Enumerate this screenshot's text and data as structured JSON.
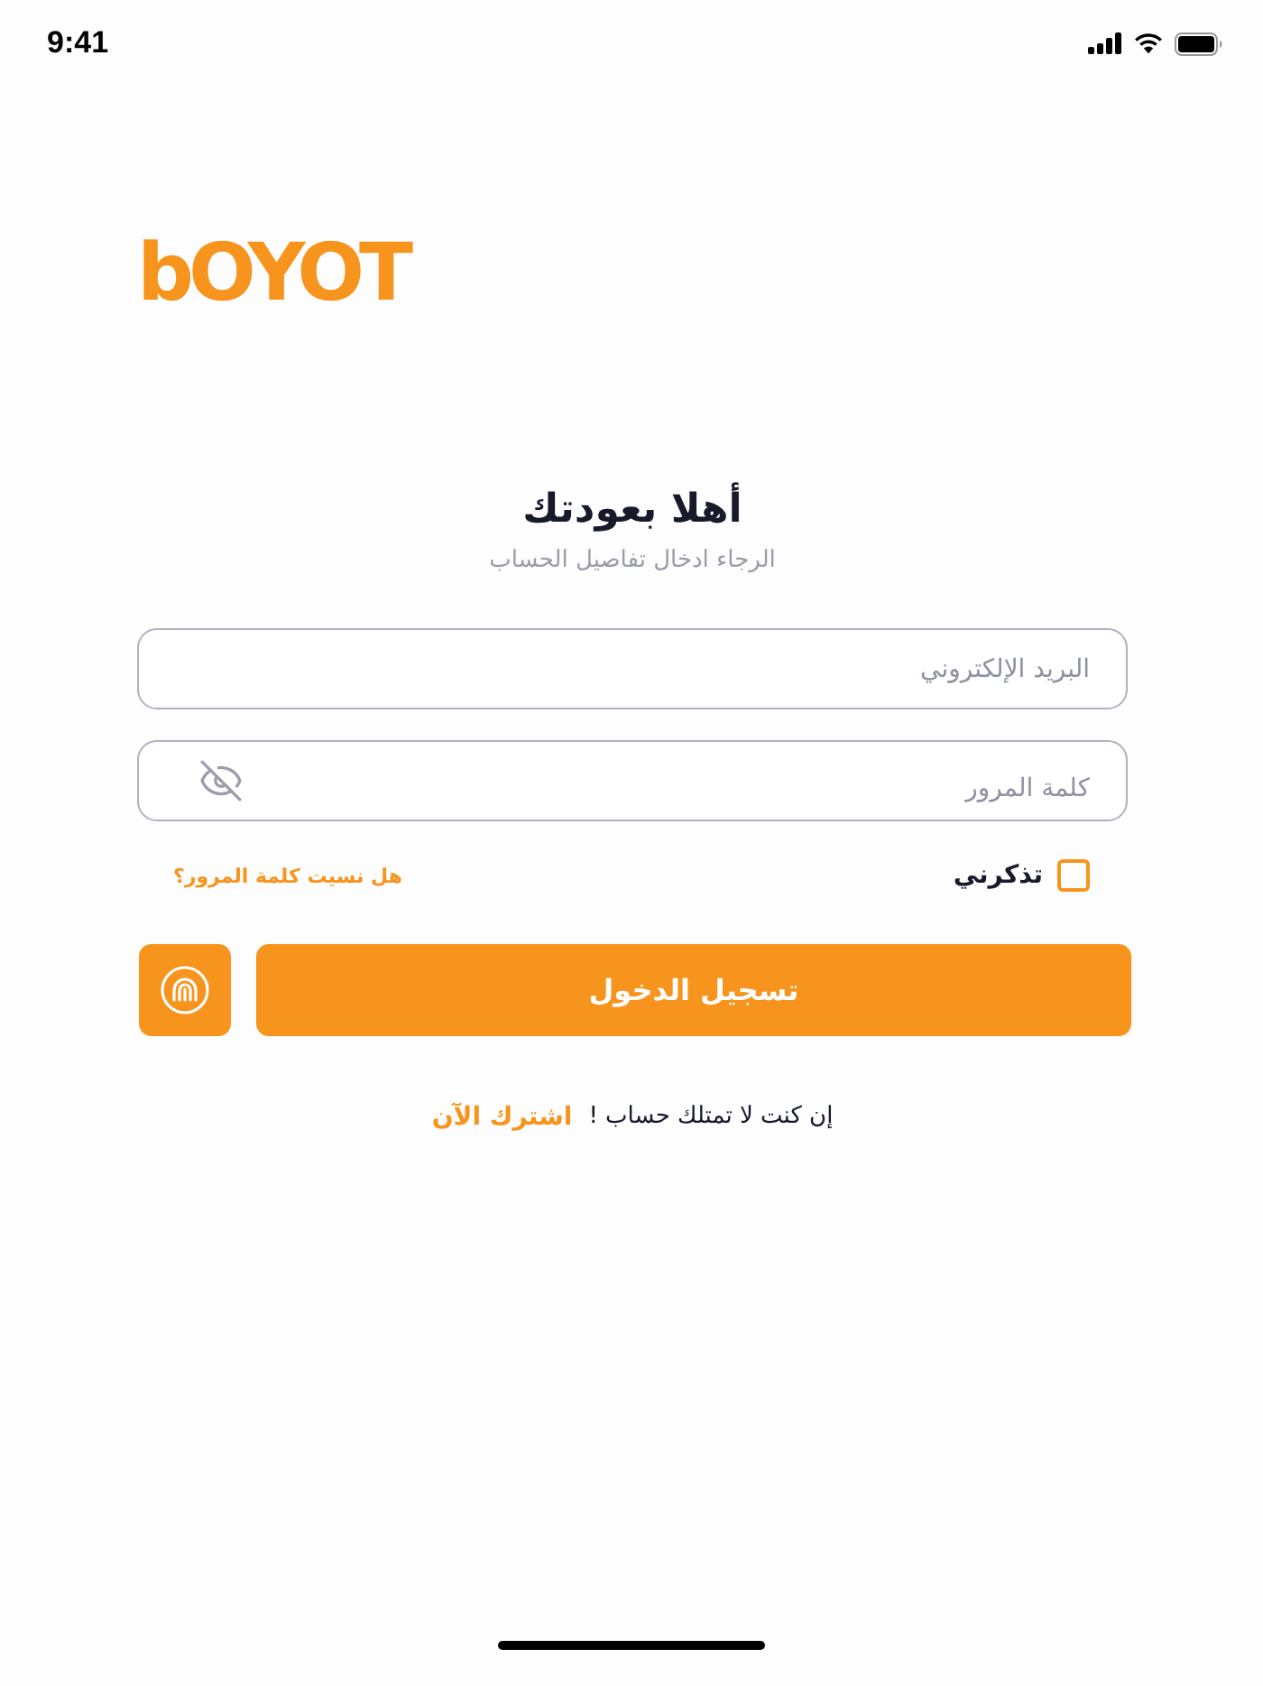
{
  "status_bar": {
    "time": "9:41"
  },
  "logo": {
    "text": "bOYOT"
  },
  "header": {
    "title": "أهلا بعودتك",
    "subtitle": "الرجاء ادخال تفاصيل الحساب"
  },
  "form": {
    "fields": [
      {
        "kind": "email",
        "placeholder": "البريد الإلكتروني"
      },
      {
        "kind": "password",
        "placeholder": "كلمة المرور",
        "password_visible": false
      }
    ],
    "remember_me": {
      "label": "تذكرني",
      "checked": false
    },
    "forgot_password": "هل نسيت كلمة المرور؟",
    "submit": "تسجيل الدخول"
  },
  "signup": {
    "prompt": "إن كنت لا تمتلك حساب !",
    "link": "اشترك الآن"
  }
}
